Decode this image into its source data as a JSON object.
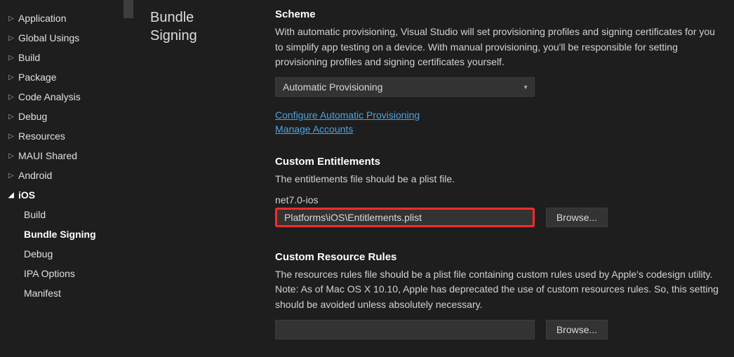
{
  "sidebar": {
    "items": [
      {
        "label": "Application",
        "expanded": false
      },
      {
        "label": "Global Usings",
        "expanded": false
      },
      {
        "label": "Build",
        "expanded": false
      },
      {
        "label": "Package",
        "expanded": false
      },
      {
        "label": "Code Analysis",
        "expanded": false
      },
      {
        "label": "Debug",
        "expanded": false
      },
      {
        "label": "Resources",
        "expanded": false
      },
      {
        "label": "MAUI Shared",
        "expanded": false
      },
      {
        "label": "Android",
        "expanded": false
      },
      {
        "label": "iOS",
        "expanded": true
      }
    ],
    "ios_subitems": [
      {
        "label": "Build",
        "active": false
      },
      {
        "label": "Bundle Signing",
        "active": true
      },
      {
        "label": "Debug",
        "active": false
      },
      {
        "label": "IPA Options",
        "active": false
      },
      {
        "label": "Manifest",
        "active": false
      }
    ]
  },
  "middle": {
    "title_line1": "Bundle",
    "title_line2": "Signing"
  },
  "main": {
    "scheme": {
      "heading": "Scheme",
      "desc": "With automatic provisioning, Visual Studio will set provisioning profiles and signing certificates for you to simplify app testing on a device. With manual provisioning, you'll be responsible for setting provisioning profiles and signing certificates yourself.",
      "dropdown_value": "Automatic Provisioning",
      "link1": "Configure Automatic Provisioning",
      "link2": "Manage Accounts"
    },
    "entitlements": {
      "heading": "Custom Entitlements",
      "desc": "The entitlements file should be a plist file.",
      "target": "net7.0-ios",
      "value": "Platforms\\iOS\\Entitlements.plist",
      "browse": "Browse..."
    },
    "resource_rules": {
      "heading": "Custom Resource Rules",
      "desc": "The resources rules file should be a plist file containing custom rules used by Apple's codesign utility. Note: As of Mac OS X 10.10, Apple has deprecated the use of custom resources rules. So, this setting should be avoided unless absolutely necessary.",
      "value": "",
      "browse": "Browse..."
    }
  }
}
